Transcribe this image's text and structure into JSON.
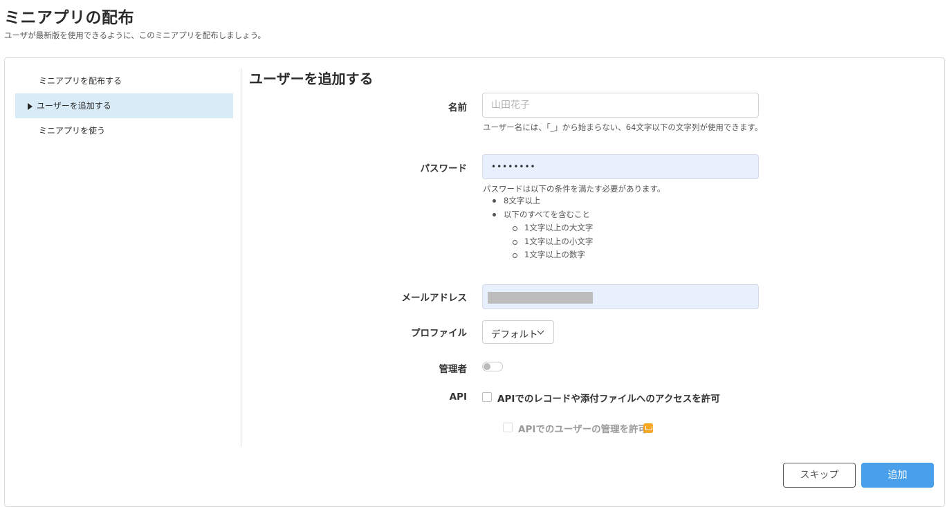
{
  "header": {
    "title": "ミニアプリの配布",
    "subtitle": "ユーザが最新版を使用できるように、このミニアプリを配布しましょう。"
  },
  "steps": [
    {
      "label": "ミニアプリを配布する",
      "active": false
    },
    {
      "label": "ユーザーを追加する",
      "active": true
    },
    {
      "label": "ミニアプリを使う",
      "active": false
    }
  ],
  "form": {
    "title": "ユーザーを追加する",
    "name": {
      "label": "名前",
      "placeholder": "山田花子",
      "value": "",
      "hint": "ユーザー名には、「_」から始まらない、64文字以下の文字列が使用できます。"
    },
    "password": {
      "label": "パスワード",
      "value": "••••••••",
      "rules_intro": "パスワードは以下の条件を満たす必要があります。",
      "rules": [
        "8文字以上",
        "以下のすべてを含むこと"
      ],
      "subrules": [
        "1文字以上の大文字",
        "1文字以上の小文字",
        "1文字以上の数字"
      ]
    },
    "email": {
      "label": "メールアドレス",
      "value": ""
    },
    "profile": {
      "label": "プロファイル",
      "selected": "デフォルト"
    },
    "admin": {
      "label": "管理者",
      "enabled": false
    },
    "api": {
      "label": "API",
      "access_label": "APIでのレコードや添付ファイルへのアクセスを許可",
      "access_checked": false,
      "user_mgmt_label": "APIでのユーザーの管理を許可",
      "user_mgmt_checked": false,
      "user_mgmt_disabled": true,
      "premium_icon": "premium-badge-icon"
    }
  },
  "buttons": {
    "skip": "スキップ",
    "add": "追加"
  },
  "colors": {
    "active_step_bg": "#d9ebf7",
    "primary": "#4a9fea",
    "autofill_bg": "#e8f0fd",
    "premium": "#f5a623"
  }
}
